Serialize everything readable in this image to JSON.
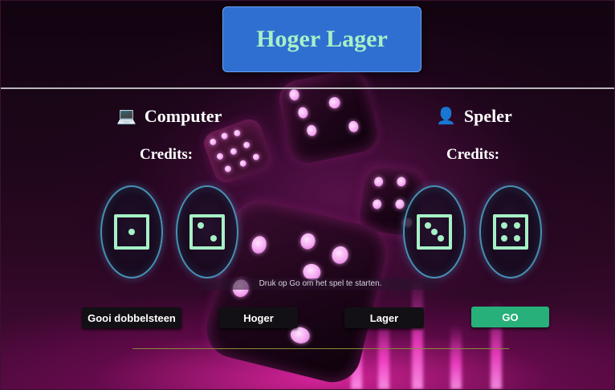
{
  "title": "Hoger Lager",
  "computer": {
    "icon": "laptop-icon",
    "icon_glyph": "💻",
    "label": "Computer",
    "credits_label": "Credits:",
    "credits_value": "",
    "dice": [
      1,
      2
    ]
  },
  "player": {
    "icon": "person-icon",
    "icon_glyph": "👤",
    "label": "Speler",
    "credits_label": "Credits:",
    "credits_value": "",
    "dice": [
      3,
      4
    ]
  },
  "status_message": "Druk op Go om het spel te starten.",
  "buttons": {
    "roll": "Gooi dobbelsteen",
    "higher": "Hoger",
    "lower": "Lager",
    "go": "GO"
  },
  "colors": {
    "title_bg": "#2f6fd1",
    "title_text": "#a6f0c6",
    "die_face": "#a6f0c6",
    "go_button": "#27b079",
    "dark_button": "#121014"
  }
}
